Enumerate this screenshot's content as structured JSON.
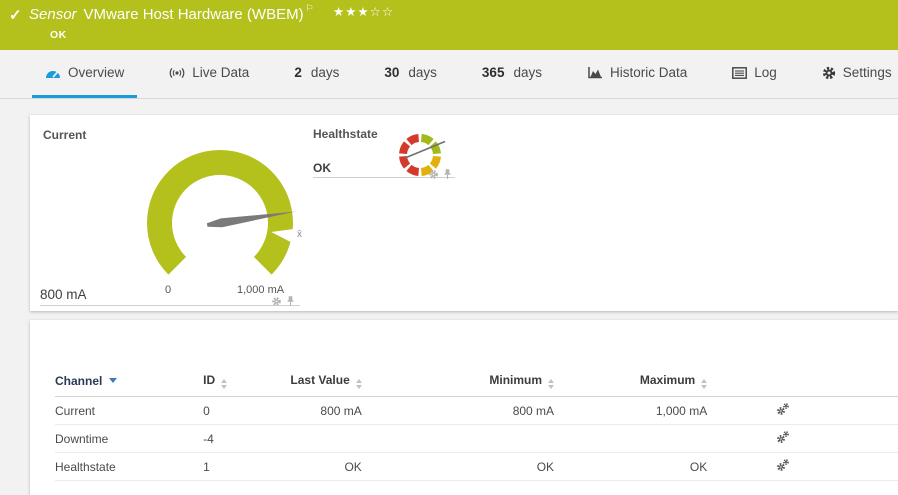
{
  "header": {
    "check_icon": "✓",
    "kind_label": "Sensor",
    "title": "VMware Host Hardware (WBEM)",
    "flag_icon": "⚐",
    "stars_filled": "★★★",
    "stars_empty": "☆☆",
    "status": "OK",
    "bar_color": "#b4c01c"
  },
  "tabs": [
    {
      "label": "Overview",
      "icon": "gauge-icon",
      "active": true
    },
    {
      "label": "Live Data",
      "icon": "broadcast-icon"
    },
    {
      "number": "2",
      "label": "days"
    },
    {
      "number": "30",
      "label": "days"
    },
    {
      "number": "365",
      "label": "days"
    },
    {
      "label": "Historic Data",
      "icon": "area-chart-icon"
    },
    {
      "label": "Log",
      "icon": "log-icon"
    },
    {
      "label": "Settings",
      "icon": "gear-icon"
    }
  ],
  "accent": {
    "tab_underline": "#1a9cd8"
  },
  "chart_data": [
    {
      "type": "gauge",
      "title": "Current",
      "value": 800,
      "min": 0,
      "max": 1000,
      "average_marker": 870,
      "unit": "mA",
      "value_text": "800 mA",
      "min_label": "0",
      "max_label": "1,000 mA",
      "avg_symbol": "x̄",
      "arc_color": "#b4c01c",
      "needle_color": "#7a7a7a",
      "sweep_deg": 270
    },
    {
      "type": "gauge",
      "title": "Healthstate",
      "value_text": "OK",
      "segment_colors": [
        "#a3b919",
        "#a3b919",
        "#e2b00a",
        "#e2b00a",
        "#d33a2c",
        "#d33a2c",
        "#d33a2c",
        "#d33a2c"
      ],
      "needle_color": "#707070"
    }
  ],
  "table": {
    "columns": [
      {
        "label": "Channel",
        "sort": "desc"
      },
      {
        "label": "ID",
        "sort": "none"
      },
      {
        "label": "Last Value",
        "sort": "none"
      },
      {
        "label": "Minimum",
        "sort": "none"
      },
      {
        "label": "Maximum",
        "sort": "none"
      }
    ],
    "rows": [
      {
        "channel": "Current",
        "id": "0",
        "last": "800 mA",
        "min": "800 mA",
        "max": "1,000 mA"
      },
      {
        "channel": "Downtime",
        "id": "-4",
        "last": "",
        "min": "",
        "max": ""
      },
      {
        "channel": "Healthstate",
        "id": "1",
        "last": "OK",
        "min": "OK",
        "max": "OK"
      }
    ]
  }
}
